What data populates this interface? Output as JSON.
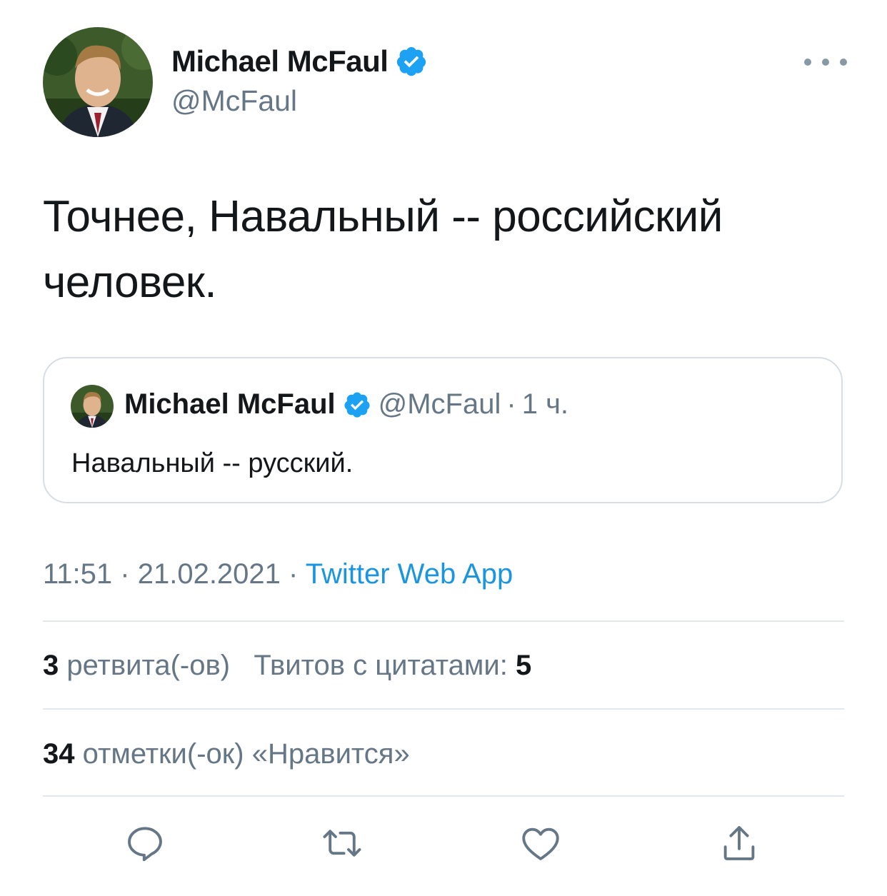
{
  "author": {
    "display_name": "Michael McFaul",
    "handle": "@McFaul"
  },
  "tweet": {
    "text": "Точнее, Навальный -- российский человек."
  },
  "quoted_tweet": {
    "display_name": "Michael McFaul",
    "handle": "@McFaul",
    "separator": "·",
    "time_ago": "1 ч.",
    "text": "Навальный -- русский."
  },
  "meta": {
    "time": "11:51",
    "separator": "·",
    "date": "21.02.2021",
    "source": "Twitter Web App"
  },
  "stats": {
    "retweets_count": "3",
    "retweets_label": "ретвита(-ов)",
    "quotes_label": "Твитов с цитатами:",
    "quotes_count": "5",
    "likes_count": "34",
    "likes_label": "отметки(-ок) «Нравится»"
  },
  "actions": {
    "icons": [
      "reply-icon",
      "retweet-icon",
      "like-icon",
      "share-icon"
    ]
  },
  "colors": {
    "text": "#14171a",
    "secondary": "#657786",
    "accent": "#1b95e0",
    "verified": "#1da1f2",
    "border": "#e1e8ed"
  }
}
